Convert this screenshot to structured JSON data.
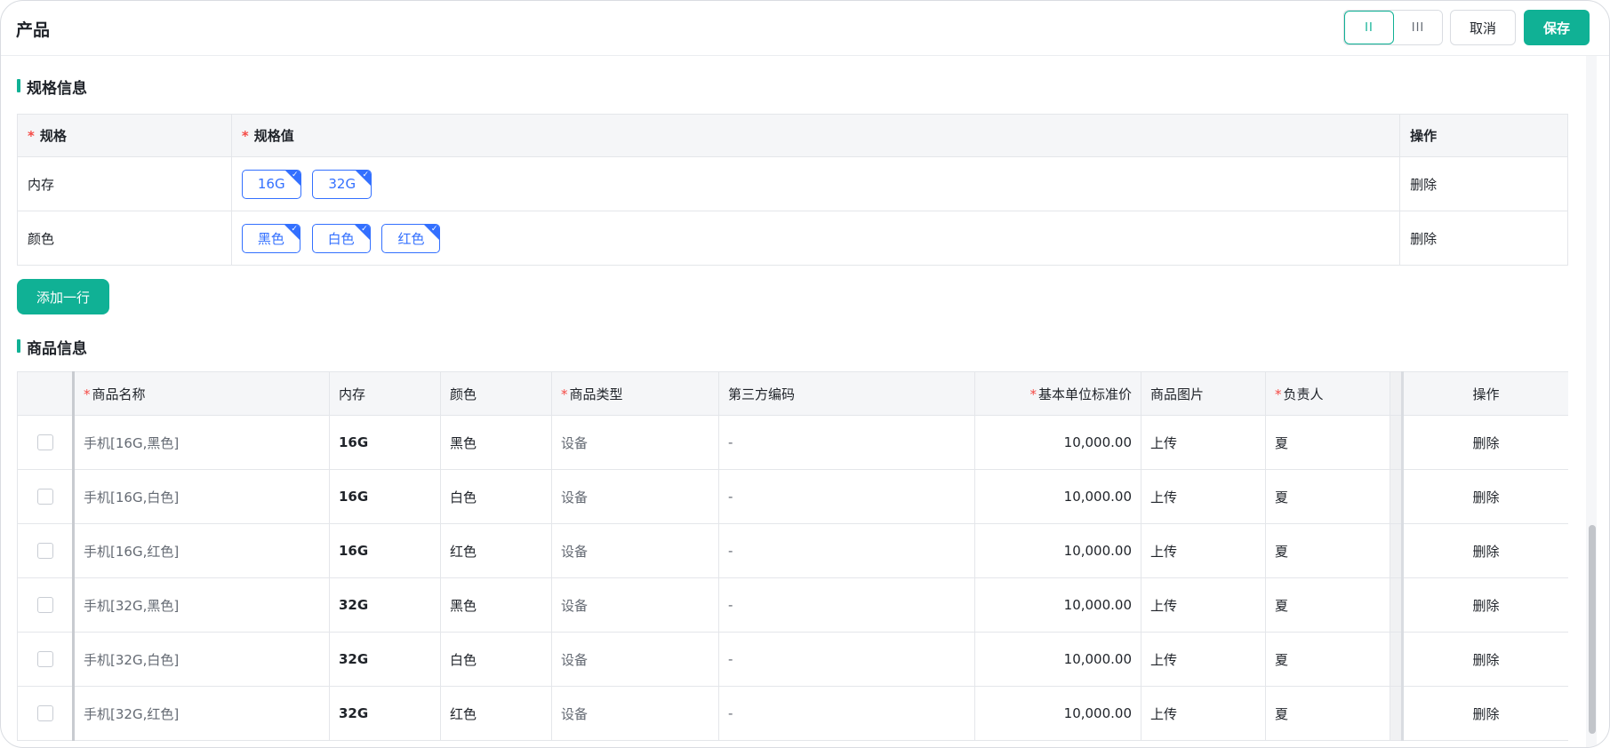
{
  "header": {
    "title": "产品",
    "layout_two": "II",
    "layout_three": "III",
    "cancel_label": "取消",
    "save_label": "保存"
  },
  "spec_section": {
    "title": "规格信息",
    "columns": {
      "spec": "规格",
      "spec_value": "规格值",
      "action": "操作"
    },
    "rows": [
      {
        "name": "内存",
        "values": [
          "16G",
          "32G"
        ],
        "action": "删除"
      },
      {
        "name": "颜色",
        "values": [
          "黑色",
          "白色",
          "红色"
        ],
        "action": "删除"
      }
    ],
    "add_row_label": "添加一行"
  },
  "product_section": {
    "title": "商品信息",
    "columns": {
      "name": "商品名称",
      "memory": "内存",
      "color": "颜色",
      "type": "商品类型",
      "third_code": "第三方编码",
      "price": "基本单位标准价",
      "image": "商品图片",
      "owner": "负责人",
      "action": "操作"
    },
    "rows": [
      {
        "name": "手机[16G,黑色]",
        "memory": "16G",
        "color": "黑色",
        "type": "设备",
        "third_code": "-",
        "price": "10,000.00",
        "image": "上传",
        "owner": "夏",
        "action": "删除"
      },
      {
        "name": "手机[16G,白色]",
        "memory": "16G",
        "color": "白色",
        "type": "设备",
        "third_code": "-",
        "price": "10,000.00",
        "image": "上传",
        "owner": "夏",
        "action": "删除"
      },
      {
        "name": "手机[16G,红色]",
        "memory": "16G",
        "color": "红色",
        "type": "设备",
        "third_code": "-",
        "price": "10,000.00",
        "image": "上传",
        "owner": "夏",
        "action": "删除"
      },
      {
        "name": "手机[32G,黑色]",
        "memory": "32G",
        "color": "黑色",
        "type": "设备",
        "third_code": "-",
        "price": "10,000.00",
        "image": "上传",
        "owner": "夏",
        "action": "删除"
      },
      {
        "name": "手机[32G,白色]",
        "memory": "32G",
        "color": "白色",
        "type": "设备",
        "third_code": "-",
        "price": "10,000.00",
        "image": "上传",
        "owner": "夏",
        "action": "删除"
      },
      {
        "name": "手机[32G,红色]",
        "memory": "32G",
        "color": "红色",
        "type": "设备",
        "third_code": "-",
        "price": "10,000.00",
        "image": "上传",
        "owner": "夏",
        "action": "删除"
      }
    ]
  },
  "colors": {
    "accent": "#10b195",
    "tag_blue": "#3370ff",
    "required": "#f54a45"
  }
}
